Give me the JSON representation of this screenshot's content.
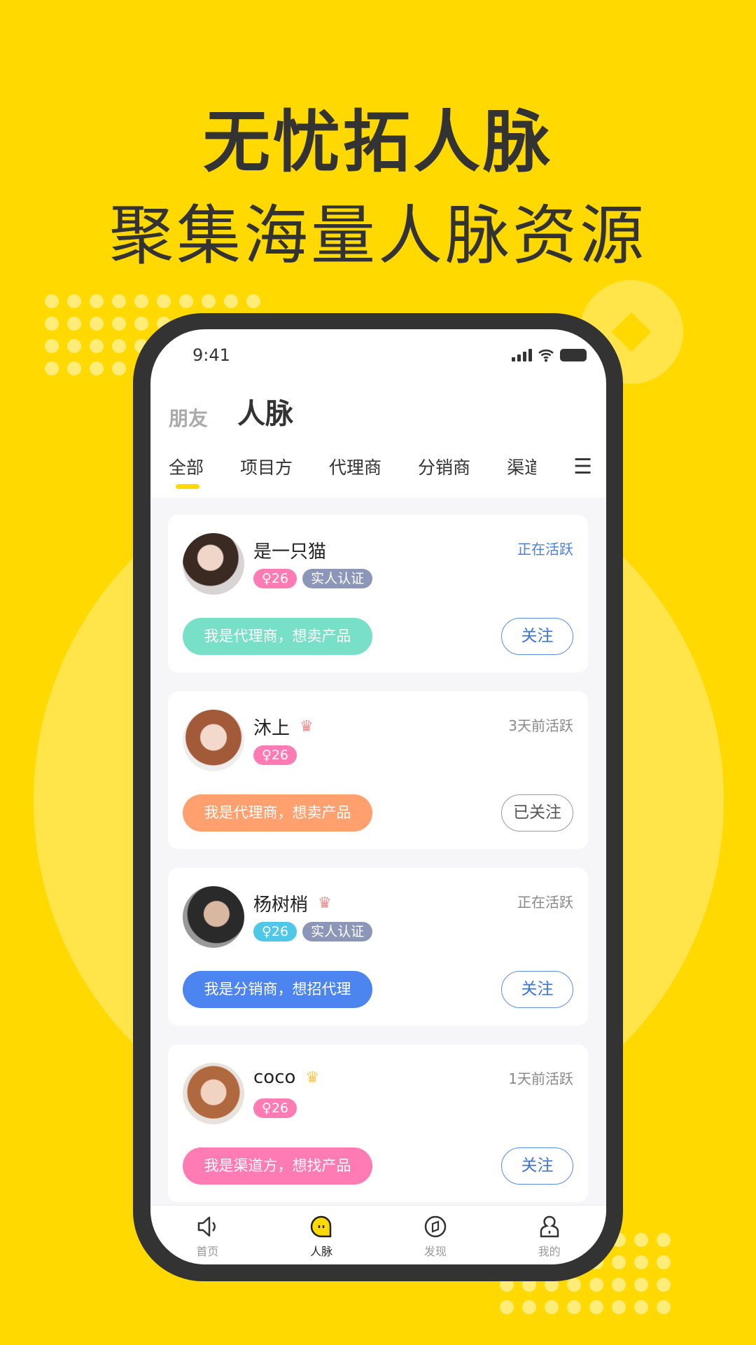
{
  "headline": {
    "line1": "无忧拓人脉",
    "line2": "聚集海量人脉资源"
  },
  "colors": {
    "background": "#FFD900",
    "accent": "#FFD900",
    "blue": "#3B73E0"
  },
  "status_bar": {
    "time": "9:41"
  },
  "header": {
    "friends": "朋友",
    "contacts": "人脉"
  },
  "tabs": [
    {
      "label": "全部",
      "active": true
    },
    {
      "label": "项目方"
    },
    {
      "label": "代理商"
    },
    {
      "label": "分销商"
    },
    {
      "label": "渠道"
    }
  ],
  "cards": [
    {
      "name": "是一只猫",
      "crown": false,
      "age": "♀26",
      "age_color": "#FF7BB3",
      "verified": "实人认证",
      "status": "正在活跃",
      "status_color": "#4A7FE0",
      "intro": "我是代理商，想卖产品",
      "intro_color": "#79E0C8",
      "follow": "关注",
      "followed": false
    },
    {
      "name": "沐上",
      "crown": true,
      "crown_color": "#F58A8A",
      "age": "♀26",
      "age_color": "#FF7BB3",
      "verified": "",
      "status": "3天前活跃",
      "status_color": "#888",
      "intro": "我是代理商，想卖产品",
      "intro_color": "#FFA06E",
      "follow": "已关注",
      "followed": true
    },
    {
      "name": "杨树梢",
      "crown": true,
      "crown_color": "#F58A8A",
      "age": "♀26",
      "age_color": "#4FC8E8",
      "verified": "实人认证",
      "status": "正在活跃",
      "status_color": "#888",
      "intro": "我是分销商，想招代理",
      "intro_color": "#4C84F0",
      "follow": "关注",
      "followed": false
    },
    {
      "name": "coco",
      "crown": true,
      "crown_color": "#FFC84A",
      "age": "♀26",
      "age_color": "#FF7BB3",
      "verified": "",
      "status": "1天前活跃",
      "status_color": "#888",
      "intro": "我是渠道方，想找产品",
      "intro_color": "#FF7BB3",
      "follow": "关注",
      "followed": false
    }
  ],
  "nav": [
    {
      "label": "首页",
      "icon": "speaker-icon"
    },
    {
      "label": "人脉",
      "icon": "chat-bubble-icon",
      "active": true
    },
    {
      "label": "发现",
      "icon": "compass-icon"
    },
    {
      "label": "我的",
      "icon": "person-icon"
    }
  ]
}
